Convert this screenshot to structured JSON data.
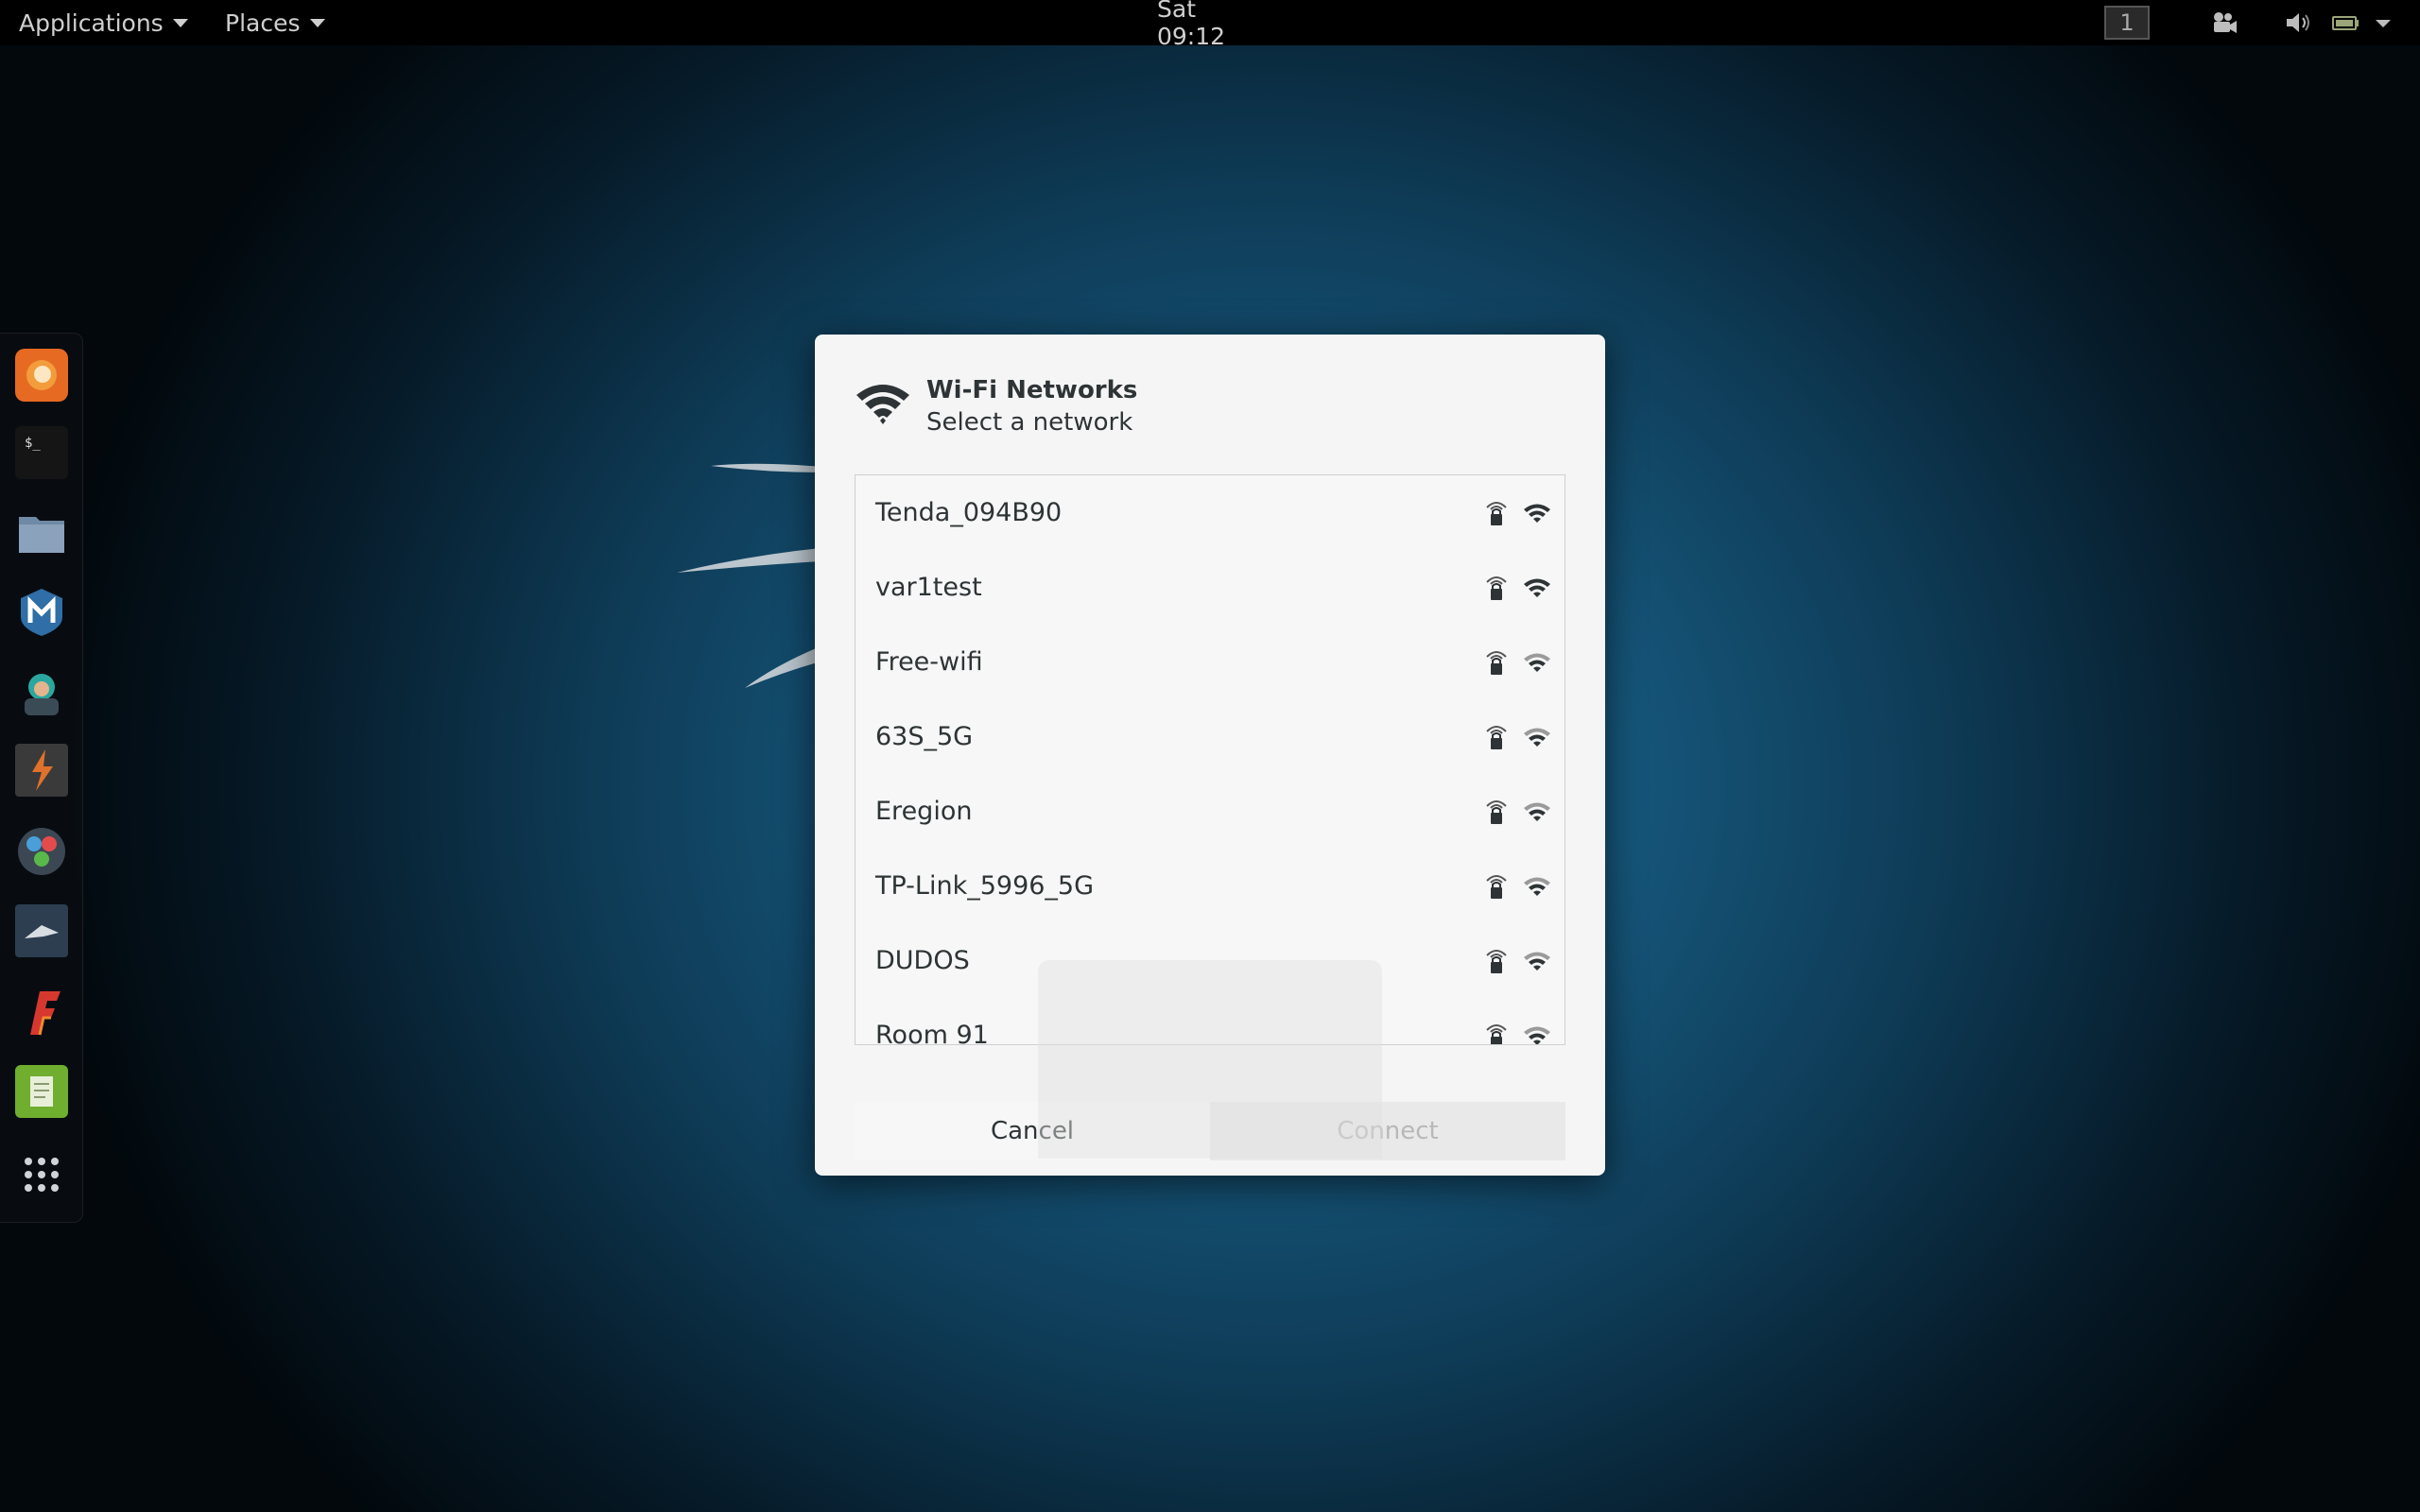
{
  "topbar": {
    "applications_label": "Applications",
    "places_label": "Places",
    "clock": "Sat 09:12",
    "workspace": "1"
  },
  "dock": {
    "items": [
      "firefox-icon",
      "terminal-icon",
      "files-icon",
      "metasploit-icon",
      "armitage-icon",
      "burpsuite-icon",
      "maltego-icon",
      "beef-icon",
      "faraday-icon",
      "leafpad-icon",
      "show-apps-icon"
    ]
  },
  "dialog": {
    "title": "Wi-Fi Networks",
    "subtitle": "Select a network",
    "networks": [
      {
        "ssid": "Tenda_094B90"
      },
      {
        "ssid": "var1test"
      },
      {
        "ssid": "Free-wifi"
      },
      {
        "ssid": "63S_5G"
      },
      {
        "ssid": "Eregion"
      },
      {
        "ssid": "TP-Link_5996_5G"
      },
      {
        "ssid": "DUDOS"
      },
      {
        "ssid": "Room 91"
      }
    ],
    "cancel_label": "Cancel",
    "connect_label": "Connect"
  },
  "colors": {
    "dialog_bg": "#f5f5f5",
    "text": "#2e3436",
    "disabled_text": "#b8b8b8",
    "topbar_bg": "#000000"
  }
}
